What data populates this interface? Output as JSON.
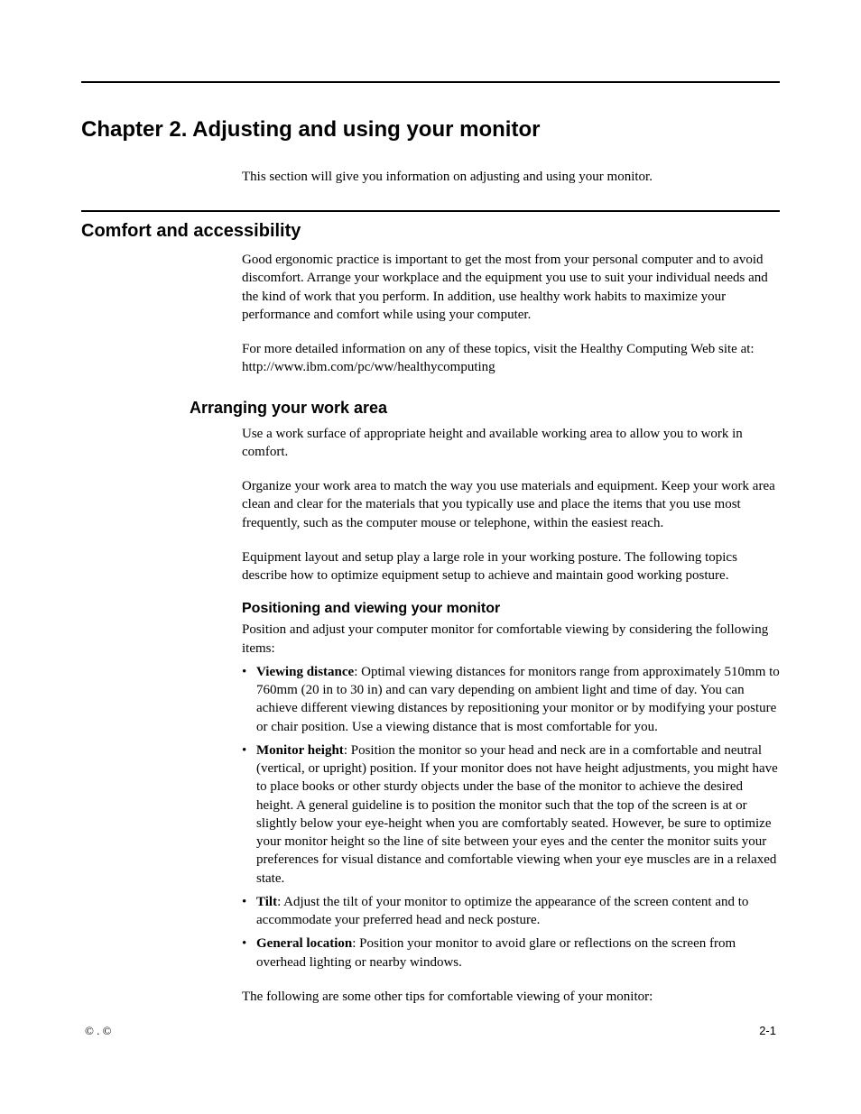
{
  "chapter_title": "Chapter 2. Adjusting and using your monitor",
  "intro": "This section will give you information on adjusting and using your monitor.",
  "section1": {
    "heading": "Comfort and accessibility",
    "p1": "Good ergonomic practice is important to get the most from your personal computer and to avoid discomfort. Arrange your workplace and the equipment you use to suit your individual needs and the kind of work that you perform. In addition, use healthy work habits to maximize your performance and comfort while using your computer.",
    "p2": "For more detailed information on any of these topics, visit the Healthy Computing Web site at: http://www.ibm.com/pc/ww/healthycomputing"
  },
  "section2": {
    "heading": "Arranging your work area",
    "p1": "Use a work surface of appropriate height and available working area to allow you to work in comfort.",
    "p2": "Organize your work area to match the way you use materials and equipment. Keep your work area clean and clear for the materials that you typically use and place the items that you use most frequently, such as the computer mouse or telephone, within the easiest reach.",
    "p3": "Equipment layout and setup play a large role in your working posture. The following topics describe how to optimize equipment setup to achieve and maintain good working posture."
  },
  "section3": {
    "heading": "Positioning and viewing your monitor",
    "intro": "Position and adjust your computer monitor for comfortable viewing by considering the following items:",
    "items": [
      {
        "label": "Viewing distance",
        "text": ": Optimal viewing distances for monitors range from approximately 510mm to 760mm (20 in to 30 in) and can vary depending on ambient light and time of day. You can achieve different viewing distances by repositioning your monitor or by modifying your posture or chair position. Use a viewing distance that is most comfortable for you."
      },
      {
        "label": "Monitor height",
        "text": ": Position the monitor so your head and neck are in a comfortable and neutral (vertical, or upright) position. If your monitor does not have height adjustments, you might have to place books or other sturdy objects under the base of the monitor to achieve the desired height. A general guideline is to position the monitor such that the top of the screen is at or slightly below your eye-height when you are comfortably seated. However, be sure to optimize your monitor height so the line of site between your eyes and the center the monitor suits your preferences for visual distance and comfortable viewing when your eye muscles are in a relaxed state."
      },
      {
        "label": "Tilt",
        "text": ": Adjust the tilt of your monitor to optimize the appearance of the screen content and to accommodate your preferred head and neck posture."
      },
      {
        "label": "General location",
        "text": ": Position your monitor to avoid glare or reflections on the screen from overhead lighting or nearby windows."
      }
    ],
    "closing": "The following are some other tips for comfortable viewing of your monitor:"
  },
  "footer": {
    "left": "©                                 . ©",
    "right": "2-1"
  }
}
